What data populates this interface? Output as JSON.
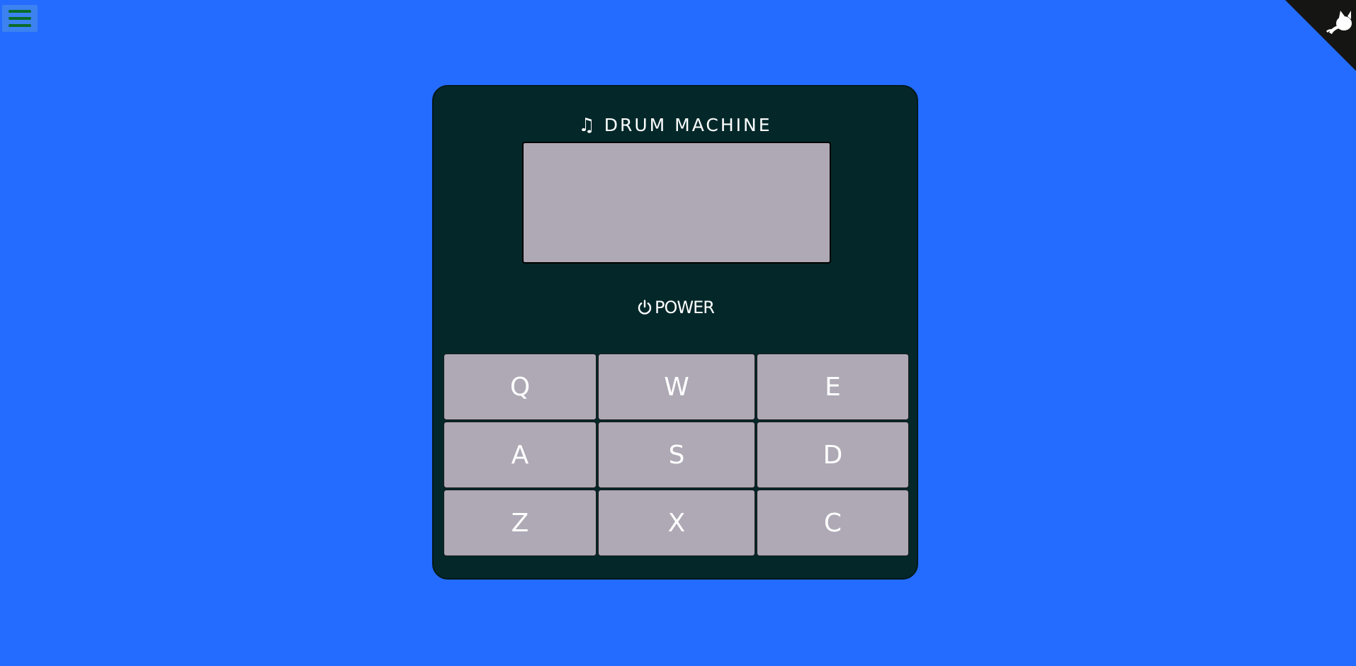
{
  "page": {
    "background_color": "#246cff"
  },
  "menu": {
    "icon": "hamburger-menu-icon",
    "color": "#0b6b2a"
  },
  "corner_link": {
    "icon": "github-octocat-icon"
  },
  "machine": {
    "title": "DRUM MACHINE",
    "title_icon": "music-note-icon",
    "display_text": "",
    "power_label": "POWER",
    "power_icon": "power-icon",
    "background_color": "#04282a",
    "pad_color": "#aea9b5",
    "pads": [
      {
        "key": "Q"
      },
      {
        "key": "W"
      },
      {
        "key": "E"
      },
      {
        "key": "A"
      },
      {
        "key": "S"
      },
      {
        "key": "D"
      },
      {
        "key": "Z"
      },
      {
        "key": "X"
      },
      {
        "key": "C"
      }
    ]
  }
}
